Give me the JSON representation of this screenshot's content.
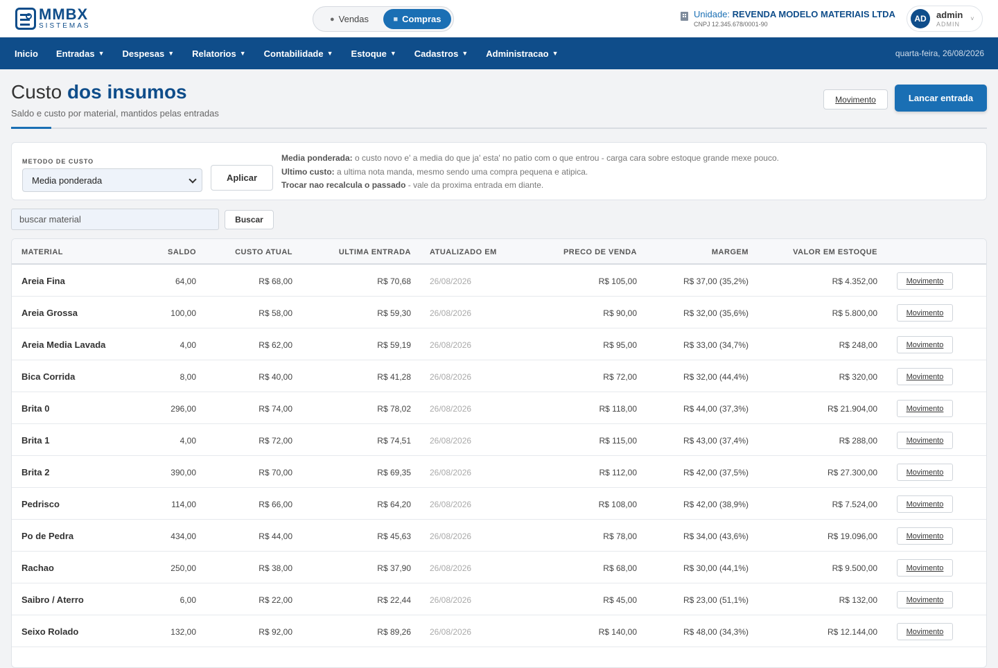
{
  "brand": {
    "name": "MMBX",
    "sub": "SISTEMAS"
  },
  "mode": {
    "vendas": "Vendas",
    "compras": "Compras"
  },
  "unit": {
    "label": "Unidade:",
    "name": "REVENDA MODELO MATERIAIS LTDA",
    "cnpj": "CNPJ 12.345.678/0001-90"
  },
  "user": {
    "initials": "AD",
    "name": "admin",
    "role": "ADMIN"
  },
  "nav": {
    "items": [
      "Inicio",
      "Entradas",
      "Despesas",
      "Relatorios",
      "Contabilidade",
      "Estoque",
      "Cadastros",
      "Administracao"
    ],
    "date": "quarta-feira, 26/08/2026"
  },
  "page": {
    "title_light": "Custo",
    "title_bold": "dos insumos",
    "subtitle": "Saldo e custo por material, mantidos pelas entradas",
    "btn_movimento": "Movimento",
    "btn_lancar": "Lancar entrada"
  },
  "method": {
    "label": "METODO DE CUSTO",
    "selected": "Media ponderada",
    "apply": "Aplicar",
    "help1_b": "Media ponderada:",
    "help1": " o custo novo e' a media do que ja' esta' no patio com o que entrou - carga cara sobre estoque grande mexe pouco.",
    "help2_b": "Ultimo custo:",
    "help2": " a ultima nota manda, mesmo sendo uma compra pequena e atipica.",
    "help3_b": "Trocar nao recalcula o passado",
    "help3": " - vale da proxima entrada em diante."
  },
  "search": {
    "placeholder": "buscar material",
    "button": "Buscar"
  },
  "table": {
    "headers": {
      "material": "MATERIAL",
      "saldo": "SALDO",
      "custo": "CUSTO ATUAL",
      "ultima": "ULTIMA ENTRADA",
      "atualizado": "ATUALIZADO EM",
      "preco": "PRECO DE VENDA",
      "margem": "MARGEM",
      "valor": "VALOR EM ESTOQUE"
    },
    "action_label": "Movimento",
    "rows": [
      {
        "material": "Areia Fina",
        "saldo": "64,00",
        "custo": "R$ 68,00",
        "ultima": "R$ 70,68",
        "atualizado": "26/08/2026",
        "preco": "R$ 105,00",
        "margem": "R$ 37,00 (35,2%)",
        "valor": "R$ 4.352,00"
      },
      {
        "material": "Areia Grossa",
        "saldo": "100,00",
        "custo": "R$ 58,00",
        "ultima": "R$ 59,30",
        "atualizado": "26/08/2026",
        "preco": "R$ 90,00",
        "margem": "R$ 32,00 (35,6%)",
        "valor": "R$ 5.800,00"
      },
      {
        "material": "Areia Media Lavada",
        "saldo": "4,00",
        "custo": "R$ 62,00",
        "ultima": "R$ 59,19",
        "atualizado": "26/08/2026",
        "preco": "R$ 95,00",
        "margem": "R$ 33,00 (34,7%)",
        "valor": "R$ 248,00"
      },
      {
        "material": "Bica Corrida",
        "saldo": "8,00",
        "custo": "R$ 40,00",
        "ultima": "R$ 41,28",
        "atualizado": "26/08/2026",
        "preco": "R$ 72,00",
        "margem": "R$ 32,00 (44,4%)",
        "valor": "R$ 320,00"
      },
      {
        "material": "Brita 0",
        "saldo": "296,00",
        "custo": "R$ 74,00",
        "ultima": "R$ 78,02",
        "atualizado": "26/08/2026",
        "preco": "R$ 118,00",
        "margem": "R$ 44,00 (37,3%)",
        "valor": "R$ 21.904,00"
      },
      {
        "material": "Brita 1",
        "saldo": "4,00",
        "custo": "R$ 72,00",
        "ultima": "R$ 74,51",
        "atualizado": "26/08/2026",
        "preco": "R$ 115,00",
        "margem": "R$ 43,00 (37,4%)",
        "valor": "R$ 288,00"
      },
      {
        "material": "Brita 2",
        "saldo": "390,00",
        "custo": "R$ 70,00",
        "ultima": "R$ 69,35",
        "atualizado": "26/08/2026",
        "preco": "R$ 112,00",
        "margem": "R$ 42,00 (37,5%)",
        "valor": "R$ 27.300,00"
      },
      {
        "material": "Pedrisco",
        "saldo": "114,00",
        "custo": "R$ 66,00",
        "ultima": "R$ 64,20",
        "atualizado": "26/08/2026",
        "preco": "R$ 108,00",
        "margem": "R$ 42,00 (38,9%)",
        "valor": "R$ 7.524,00"
      },
      {
        "material": "Po de Pedra",
        "saldo": "434,00",
        "custo": "R$ 44,00",
        "ultima": "R$ 45,63",
        "atualizado": "26/08/2026",
        "preco": "R$ 78,00",
        "margem": "R$ 34,00 (43,6%)",
        "valor": "R$ 19.096,00"
      },
      {
        "material": "Rachao",
        "saldo": "250,00",
        "custo": "R$ 38,00",
        "ultima": "R$ 37,90",
        "atualizado": "26/08/2026",
        "preco": "R$ 68,00",
        "margem": "R$ 30,00 (44,1%)",
        "valor": "R$ 9.500,00"
      },
      {
        "material": "Saibro / Aterro",
        "saldo": "6,00",
        "custo": "R$ 22,00",
        "ultima": "R$ 22,44",
        "atualizado": "26/08/2026",
        "preco": "R$ 45,00",
        "margem": "R$ 23,00 (51,1%)",
        "valor": "R$ 132,00"
      },
      {
        "material": "Seixo Rolado",
        "saldo": "132,00",
        "custo": "R$ 92,00",
        "ultima": "R$ 89,26",
        "atualizado": "26/08/2026",
        "preco": "R$ 140,00",
        "margem": "R$ 48,00 (34,3%)",
        "valor": "R$ 12.144,00"
      }
    ]
  }
}
